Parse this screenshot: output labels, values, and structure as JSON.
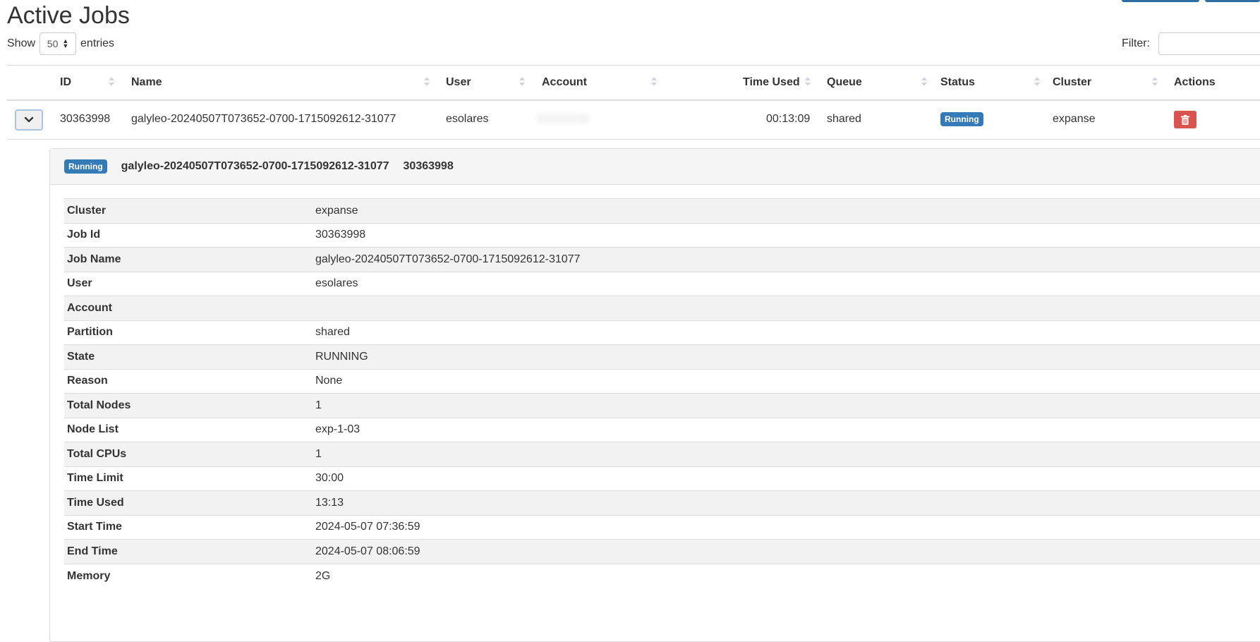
{
  "page_title": "Active Jobs",
  "length": {
    "prefix": "Show",
    "value": "50",
    "suffix": "entries"
  },
  "filter": {
    "label": "Filter:",
    "value": ""
  },
  "columns": [
    "ID",
    "Name",
    "User",
    "Account",
    "Time Used",
    "Queue",
    "Status",
    "Cluster",
    "Actions"
  ],
  "row": {
    "id": "30363998",
    "name": "galyleo-20240507T073652-0700-1715092612-31077",
    "user": "esolares",
    "account": "",
    "time_used": "00:13:09",
    "queue": "shared",
    "status": "Running",
    "cluster": "expanse"
  },
  "detail": {
    "status": "Running",
    "name": "galyleo-20240507T073652-0700-1715092612-31077",
    "id": "30363998",
    "rows": [
      {
        "key": "Cluster",
        "value": "expanse"
      },
      {
        "key": "Job Id",
        "value": "30363998"
      },
      {
        "key": "Job Name",
        "value": "galyleo-20240507T073652-0700-1715092612-31077"
      },
      {
        "key": "User",
        "value": "esolares"
      },
      {
        "key": "Account",
        "value": ""
      },
      {
        "key": "Partition",
        "value": "shared"
      },
      {
        "key": "State",
        "value": "RUNNING"
      },
      {
        "key": "Reason",
        "value": "None"
      },
      {
        "key": "Total Nodes",
        "value": "1"
      },
      {
        "key": "Node List",
        "value": "exp-1-03"
      },
      {
        "key": "Total CPUs",
        "value": "1"
      },
      {
        "key": "Time Limit",
        "value": "30:00"
      },
      {
        "key": "Time Used",
        "value": "13:13"
      },
      {
        "key": "Start Time",
        "value": "2024-05-07 07:36:59"
      },
      {
        "key": "End Time",
        "value": "2024-05-07 08:06:59"
      },
      {
        "key": "Memory",
        "value": "2G"
      }
    ]
  },
  "icons": {
    "expand": "chevron-down-icon",
    "delete": "trash-icon",
    "sort": "sort-icon"
  },
  "colors": {
    "primary": "#337ab7",
    "danger": "#d9534f",
    "stripe": "#f2f2f2"
  }
}
